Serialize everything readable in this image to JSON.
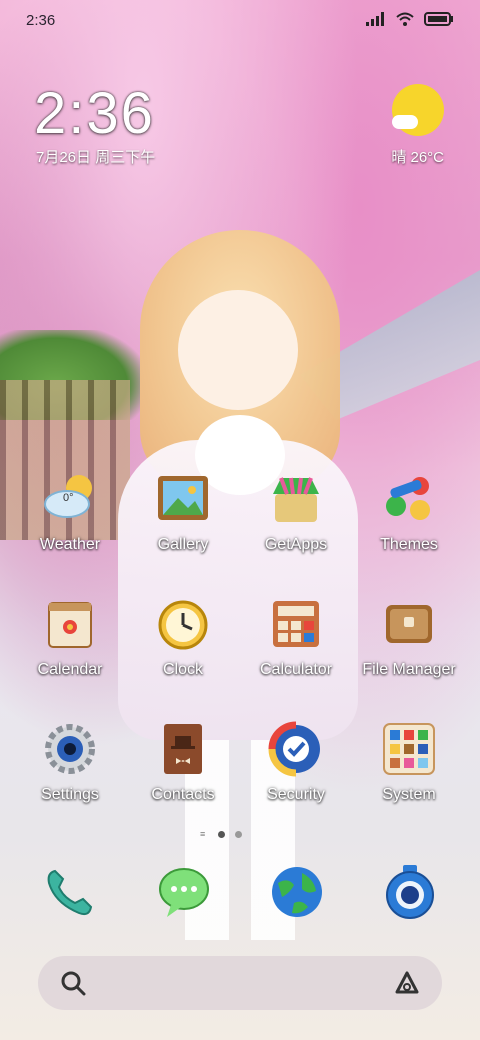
{
  "status_bar": {
    "time": "2:36"
  },
  "clock_widget": {
    "time": "2:36",
    "date": "7月26日 周三下午"
  },
  "weather_widget": {
    "condition_temp": "晴 26°C"
  },
  "apps": [
    {
      "label": "Weather",
      "icon": "weather-icon",
      "temp": "0°"
    },
    {
      "label": "Gallery",
      "icon": "gallery-icon"
    },
    {
      "label": "GetApps",
      "icon": "getapps-icon"
    },
    {
      "label": "Themes",
      "icon": "themes-icon"
    },
    {
      "label": "Calendar",
      "icon": "calendar-icon"
    },
    {
      "label": "Clock",
      "icon": "clock-icon"
    },
    {
      "label": "Calculator",
      "icon": "calculator-icon"
    },
    {
      "label": "File Manager",
      "icon": "file-manager-icon"
    },
    {
      "label": "Settings",
      "icon": "settings-icon"
    },
    {
      "label": "Contacts",
      "icon": "contacts-icon"
    },
    {
      "label": "Security",
      "icon": "security-icon"
    },
    {
      "label": "System",
      "icon": "system-folder-icon"
    }
  ],
  "page_indicator": {
    "pages": 2,
    "active": 1
  },
  "dock": [
    {
      "icon": "phone-icon"
    },
    {
      "icon": "messages-icon"
    },
    {
      "icon": "browser-icon"
    },
    {
      "icon": "camera-icon"
    }
  ],
  "search_bar": {
    "left_icon": "search-icon",
    "right_icon": "app-vault-icon"
  },
  "colors": {
    "sun": "#f7d52b",
    "text": "#ffffff"
  }
}
